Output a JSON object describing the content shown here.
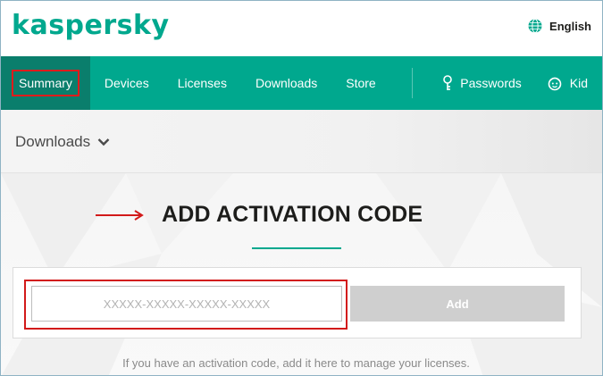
{
  "brand": {
    "logo_text": "kaspersky",
    "color": "#00a88e"
  },
  "language": {
    "label": "English",
    "icon": "globe-icon"
  },
  "nav": {
    "items": [
      {
        "label": "Summary",
        "active": true
      },
      {
        "label": "Devices"
      },
      {
        "label": "Licenses"
      },
      {
        "label": "Downloads"
      },
      {
        "label": "Store"
      }
    ],
    "right_items": [
      {
        "label": "Passwords",
        "icon": "key-icon"
      },
      {
        "label": "Kid",
        "icon": "kid-face-icon"
      }
    ]
  },
  "breadcrumb": {
    "label": "Downloads",
    "icon": "chevron-down-icon"
  },
  "main": {
    "title": "ADD ACTIVATION CODE",
    "code_input": {
      "placeholder": "XXXXX-XXXXX-XXXXX-XXXXX",
      "value": ""
    },
    "add_button_label": "Add",
    "helper_text": "If you have an activation code, add it here to manage your licenses."
  },
  "colors": {
    "accent": "#00a88e",
    "nav_active": "#0a7e6c",
    "annotation_red": "#d21a1a",
    "button_disabled": "#cfcfcf"
  }
}
